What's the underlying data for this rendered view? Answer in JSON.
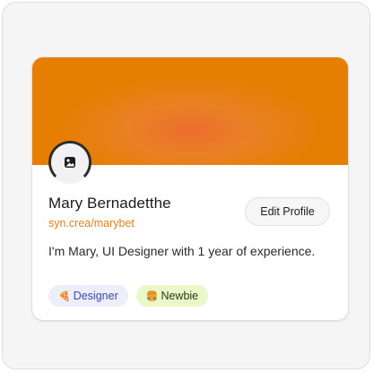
{
  "profile": {
    "name": "Mary Bernadetthe",
    "handle": "syn.crea/marybet",
    "bio": "I'm Mary, UI Designer with 1 year of experience.",
    "edit_label": "Edit Profile",
    "avatar_icon": "image-placeholder-icon"
  },
  "tags": [
    {
      "emoji": "🍕",
      "label": "Designer",
      "icon": "pizza-icon"
    },
    {
      "emoji": "🍔",
      "label": "Newbie",
      "icon": "burger-icon"
    }
  ],
  "colors": {
    "cover": "#e67e02",
    "cover_center": "#ec6d2c",
    "handle": "#e0811c",
    "designer_tag_bg": "#eceefb",
    "newbie_tag_bg": "#eaf7c9"
  }
}
